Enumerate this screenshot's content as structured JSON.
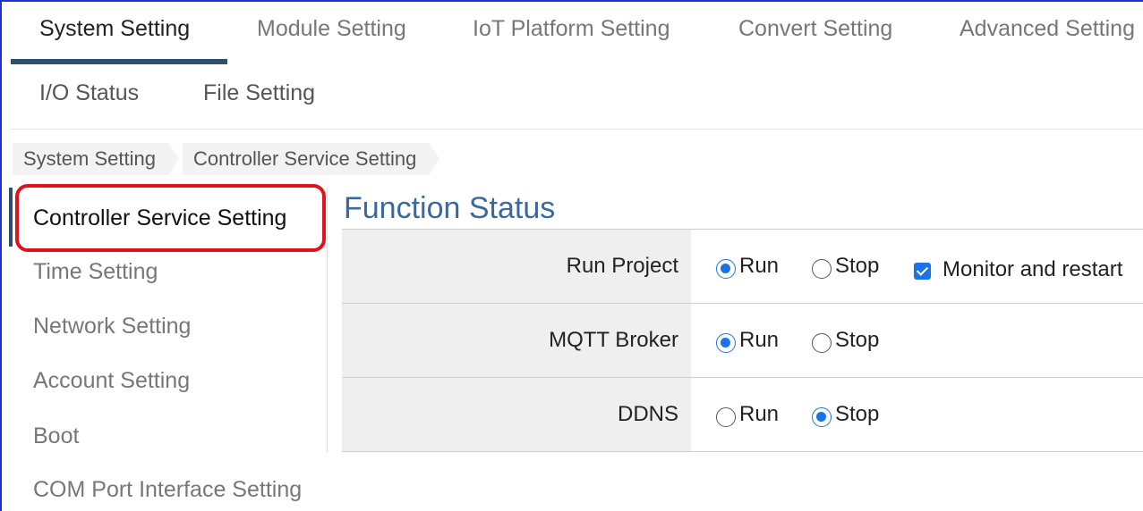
{
  "tabs": [
    {
      "label": "System Setting",
      "active": true
    },
    {
      "label": "Module Setting"
    },
    {
      "label": "IoT Platform Setting"
    },
    {
      "label": "Convert Setting"
    },
    {
      "label": "Advanced Setting"
    }
  ],
  "tabs_row2": [
    {
      "label": "I/O Status"
    },
    {
      "label": "File Setting"
    }
  ],
  "breadcrumb": [
    "System Setting",
    "Controller Service Setting"
  ],
  "sidebar": {
    "items": [
      {
        "label": "Controller Service Setting",
        "active": true
      },
      {
        "label": "Time Setting"
      },
      {
        "label": "Network Setting"
      },
      {
        "label": "Account Setting"
      },
      {
        "label": "Boot"
      },
      {
        "label": "COM Port Interface Setting"
      }
    ]
  },
  "main": {
    "title": "Function Status",
    "rows": [
      {
        "label": "Run Project",
        "run_label": "Run",
        "stop_label": "Stop",
        "selected": "Run",
        "checkbox_label": "Monitor and restart",
        "checkbox_checked": true
      },
      {
        "label": "MQTT Broker",
        "run_label": "Run",
        "stop_label": "Stop",
        "selected": "Run"
      },
      {
        "label": "DDNS",
        "run_label": "Run",
        "stop_label": "Stop",
        "selected": "Stop"
      }
    ]
  },
  "colors": {
    "accent": "#2f4f6c",
    "title": "#3b6a9a",
    "highlight": "#e0121b",
    "radio_checked": "#1a73e8",
    "frame": "#1f2fd0"
  }
}
